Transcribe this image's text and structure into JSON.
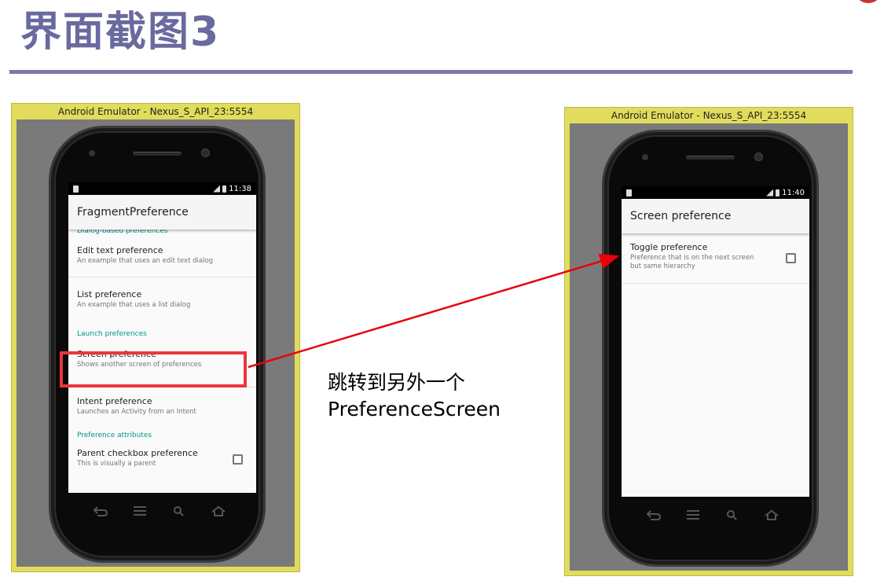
{
  "slide": {
    "title": "界面截图3",
    "caption_line1": "跳转到另外一个",
    "caption_line2": "PreferenceScreen",
    "colors": {
      "title": "#6a6aa0",
      "rule": "#7b7bab",
      "highlight": "#e8383c",
      "arrow": "#e8000a",
      "accent": "#009688",
      "emulator_frame": "#e2dc5c"
    }
  },
  "left_emulator": {
    "window_title": "Android Emulator - Nexus_S_API_23:5554",
    "status_time": "11:38",
    "app_title": "FragmentPreference",
    "clipped_category": "Dialog-based preferences",
    "items": [
      {
        "title": "Edit text preference",
        "summary": "An example that uses an edit text dialog"
      },
      {
        "title": "List preference",
        "summary": "An example that uses a list dialog"
      }
    ],
    "category_launch": "Launch preferences",
    "screen_pref": {
      "title": "Screen preference",
      "summary": "Shows another screen of preferences"
    },
    "intent_pref": {
      "title": "Intent preference",
      "summary": "Launches an Activity from an Intent"
    },
    "category_attributes": "Preference attributes",
    "parent_pref": {
      "title": "Parent checkbox preference",
      "summary": "This is visually a parent",
      "checked": false
    },
    "nav_icons": [
      "back-icon",
      "menu-icon",
      "search-icon",
      "home-icon"
    ]
  },
  "right_emulator": {
    "window_title": "Android Emulator - Nexus_S_API_23:5554",
    "status_time": "11:40",
    "app_title": "Screen preference",
    "toggle_pref": {
      "title": "Toggle preference",
      "summary_line1": "Preference that is on the next screen",
      "summary_line2": "but same hierarchy",
      "checked": false
    },
    "nav_icons": [
      "back-icon",
      "menu-icon",
      "search-icon",
      "home-icon"
    ]
  }
}
